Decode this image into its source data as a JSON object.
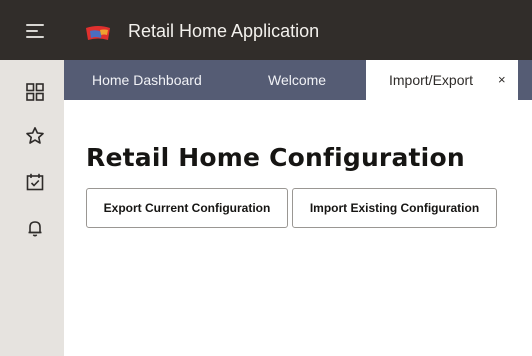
{
  "header": {
    "menu_icon": "hamburger-menu-icon",
    "logo_icon": "app-logo",
    "title": "Retail Home Application",
    "bg_color": "#312d2a"
  },
  "sidebar": {
    "items": [
      {
        "icon": "grid-icon"
      },
      {
        "icon": "star-icon"
      },
      {
        "icon": "calendar-check-icon"
      },
      {
        "icon": "bell-icon"
      }
    ]
  },
  "tabs": [
    {
      "label": "Home Dashboard",
      "active": false
    },
    {
      "label": "Welcome",
      "active": false
    },
    {
      "label": "Import/Export",
      "active": true,
      "close": "×"
    }
  ],
  "tabs_bg_color": "#555c74",
  "main": {
    "title": "Retail Home Configuration",
    "buttons": {
      "export_label": "Export Current Configuration",
      "import_label": "Import Existing Configuration"
    }
  }
}
